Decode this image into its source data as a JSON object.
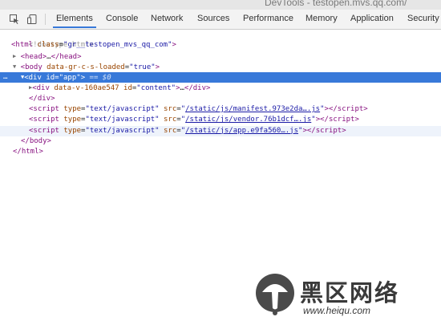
{
  "window": {
    "title": "DevTools - testopen.mvs.qq.com/"
  },
  "toolbar": {
    "tabs": [
      "Elements",
      "Console",
      "Network",
      "Sources",
      "Performance",
      "Memory",
      "Application",
      "Security"
    ],
    "active_tab": "Elements"
  },
  "dom": {
    "doctype": "<!doctype html>",
    "html": {
      "tag": "html",
      "attr": "class",
      "value": "gr__testopen_mvs_qq_com"
    },
    "head": {
      "open": "<head>",
      "ellipsis": "…",
      "close": "</head>"
    },
    "body": {
      "tag": "body",
      "attr": "data-gr-c-s-loaded",
      "value": "true"
    },
    "div_app": {
      "tag": "div",
      "attr": "id",
      "value": "app",
      "suffix": "== $0"
    },
    "div_content": {
      "tag": "div",
      "attr1": "data-v-160ae547",
      "attr2": "id",
      "value2": "content",
      "ellipsis": "…",
      "close": "</div>"
    },
    "div_close": "</div>",
    "scripts": [
      {
        "type": "text/javascript",
        "src": "/static/js/manifest.973e2da….js"
      },
      {
        "type": "text/javascript",
        "src": "/static/js/vendor.76b1dcf….js"
      },
      {
        "type": "text/javascript",
        "src": "/static/js/app.e9fa560….js"
      }
    ],
    "body_close": "</body>",
    "html_close": "</html>"
  },
  "watermark": {
    "text": "黑区网络",
    "url": "www.heiqu.com"
  }
}
